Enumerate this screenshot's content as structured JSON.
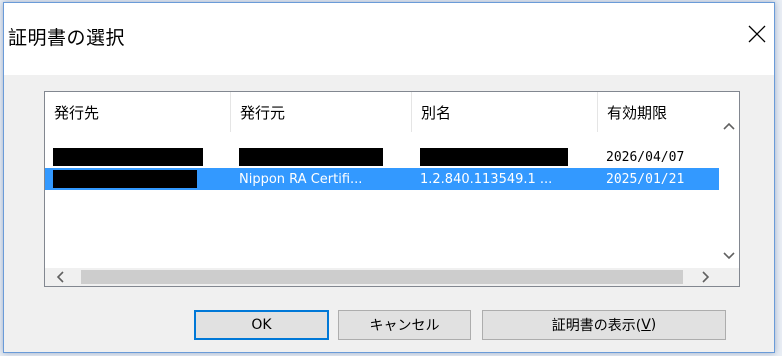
{
  "dialog": {
    "title": "証明書の選択",
    "close_label": "×"
  },
  "table": {
    "columns": [
      "発行先",
      "発行元",
      "別名",
      "有効期限"
    ],
    "rows": [
      {
        "issued_to": "",
        "issued_by": "",
        "alias": "",
        "expires": "2026/04/07",
        "selected": false
      },
      {
        "issued_to": "",
        "issued_by": "Nippon RA Certifi...",
        "alias": "1.2.840.113549.1 ...",
        "expires": "2025/01/21",
        "selected": true
      }
    ]
  },
  "buttons": {
    "ok": "OK",
    "cancel": "キャンセル",
    "view_prefix": "証明書の表示(",
    "view_accel": "V",
    "view_suffix": ")"
  },
  "icons": {
    "close": "close-icon",
    "scroll_up": "chevron-up-icon",
    "scroll_down": "chevron-down-icon",
    "scroll_left": "chevron-left-icon",
    "scroll_right": "chevron-right-icon"
  },
  "colors": {
    "selection": "#3399ff",
    "accent": "#0078d7",
    "dialog_border": "#6a9bd8"
  }
}
